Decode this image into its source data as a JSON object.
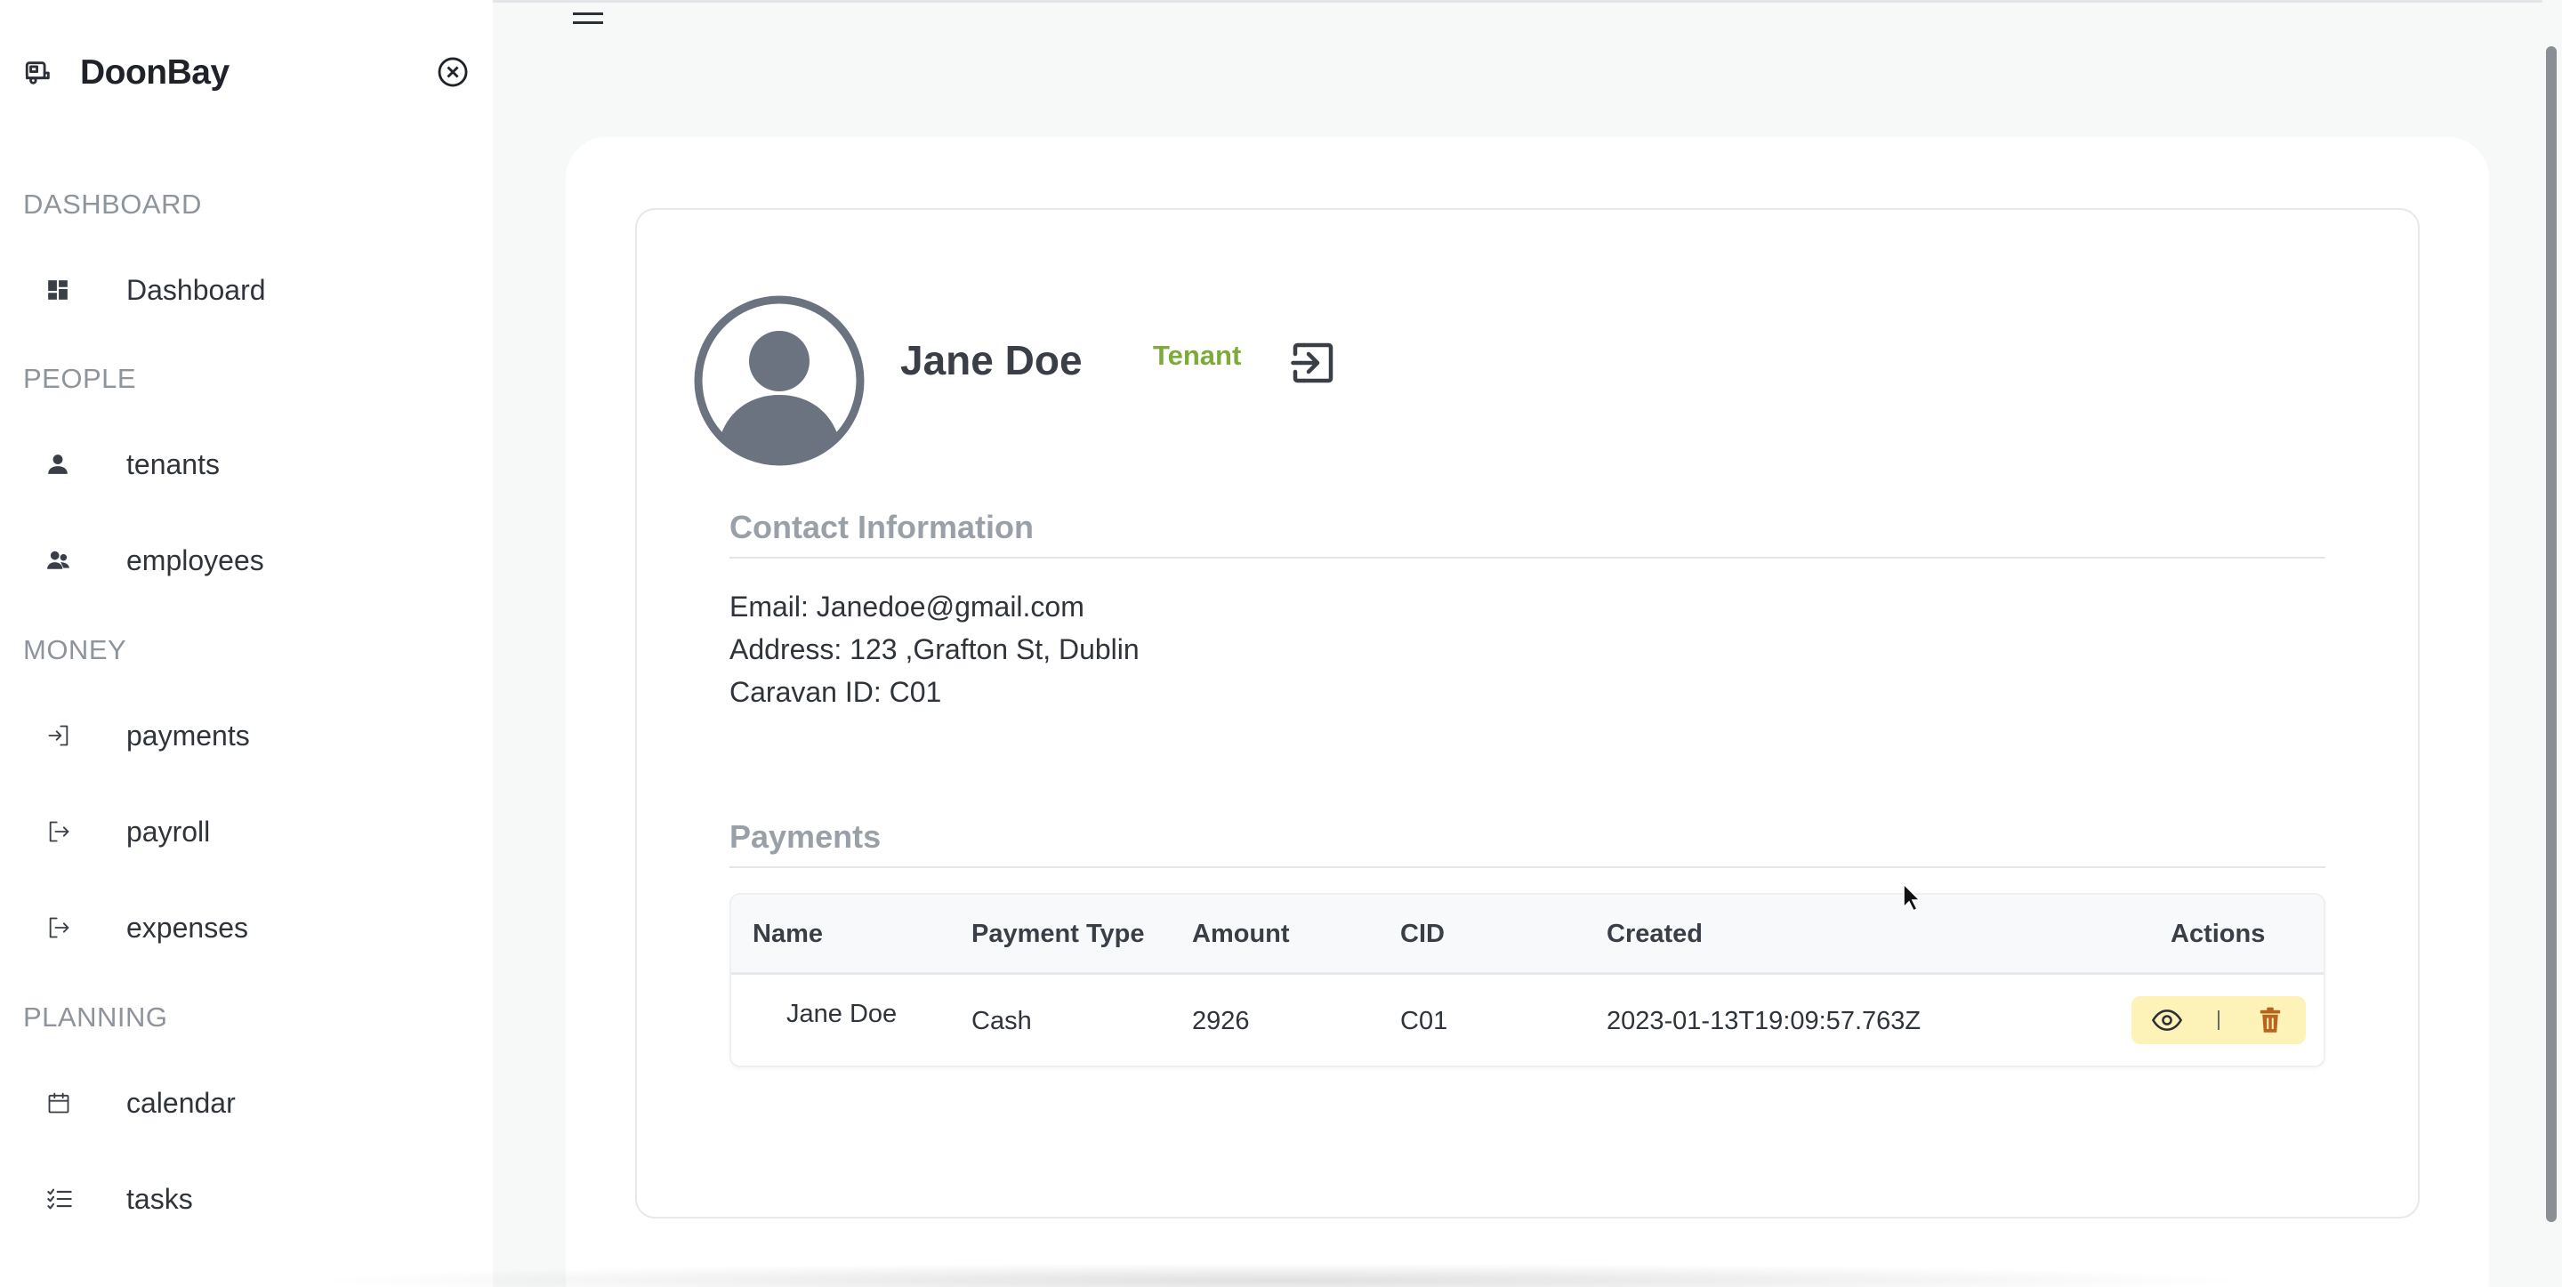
{
  "brand": {
    "name": "DoonBay",
    "icon": "caravan-icon"
  },
  "sidebar": {
    "sections": [
      {
        "label": "DASHBOARD",
        "items": [
          {
            "label": "Dashboard",
            "icon": "grid-icon"
          }
        ]
      },
      {
        "label": "PEOPLE",
        "items": [
          {
            "label": "tenants",
            "icon": "person-icon"
          },
          {
            "label": "employees",
            "icon": "people-icon"
          }
        ]
      },
      {
        "label": "MONEY",
        "items": [
          {
            "label": "payments",
            "icon": "login-icon"
          },
          {
            "label": "payroll",
            "icon": "logout-icon"
          },
          {
            "label": "expenses",
            "icon": "logout-icon"
          }
        ]
      },
      {
        "label": "PLANNING",
        "items": [
          {
            "label": "calendar",
            "icon": "calendar-icon"
          },
          {
            "label": "tasks",
            "icon": "checklist-icon"
          }
        ]
      }
    ]
  },
  "profile": {
    "name": "Jane Doe",
    "role": "Tenant",
    "role_color": "#7cab3a"
  },
  "contact": {
    "heading": "Contact Information",
    "email": "Email: Janedoe@gmail.com",
    "address": "Address: 123 ,Grafton St, Dublin",
    "caravan": "Caravan ID: C01"
  },
  "payments": {
    "heading": "Payments",
    "columns": [
      "Name",
      "Payment Type",
      "Amount",
      "CID",
      "Created",
      "Actions"
    ],
    "rows": [
      {
        "name": "Jane Doe",
        "type": "Cash",
        "amount": "2926",
        "cid": "C01",
        "created": "2023-01-13T19:09:57.763Z"
      }
    ]
  },
  "colors": {
    "accent_badge": "#fdf2b8",
    "delete": "#b5651d"
  }
}
